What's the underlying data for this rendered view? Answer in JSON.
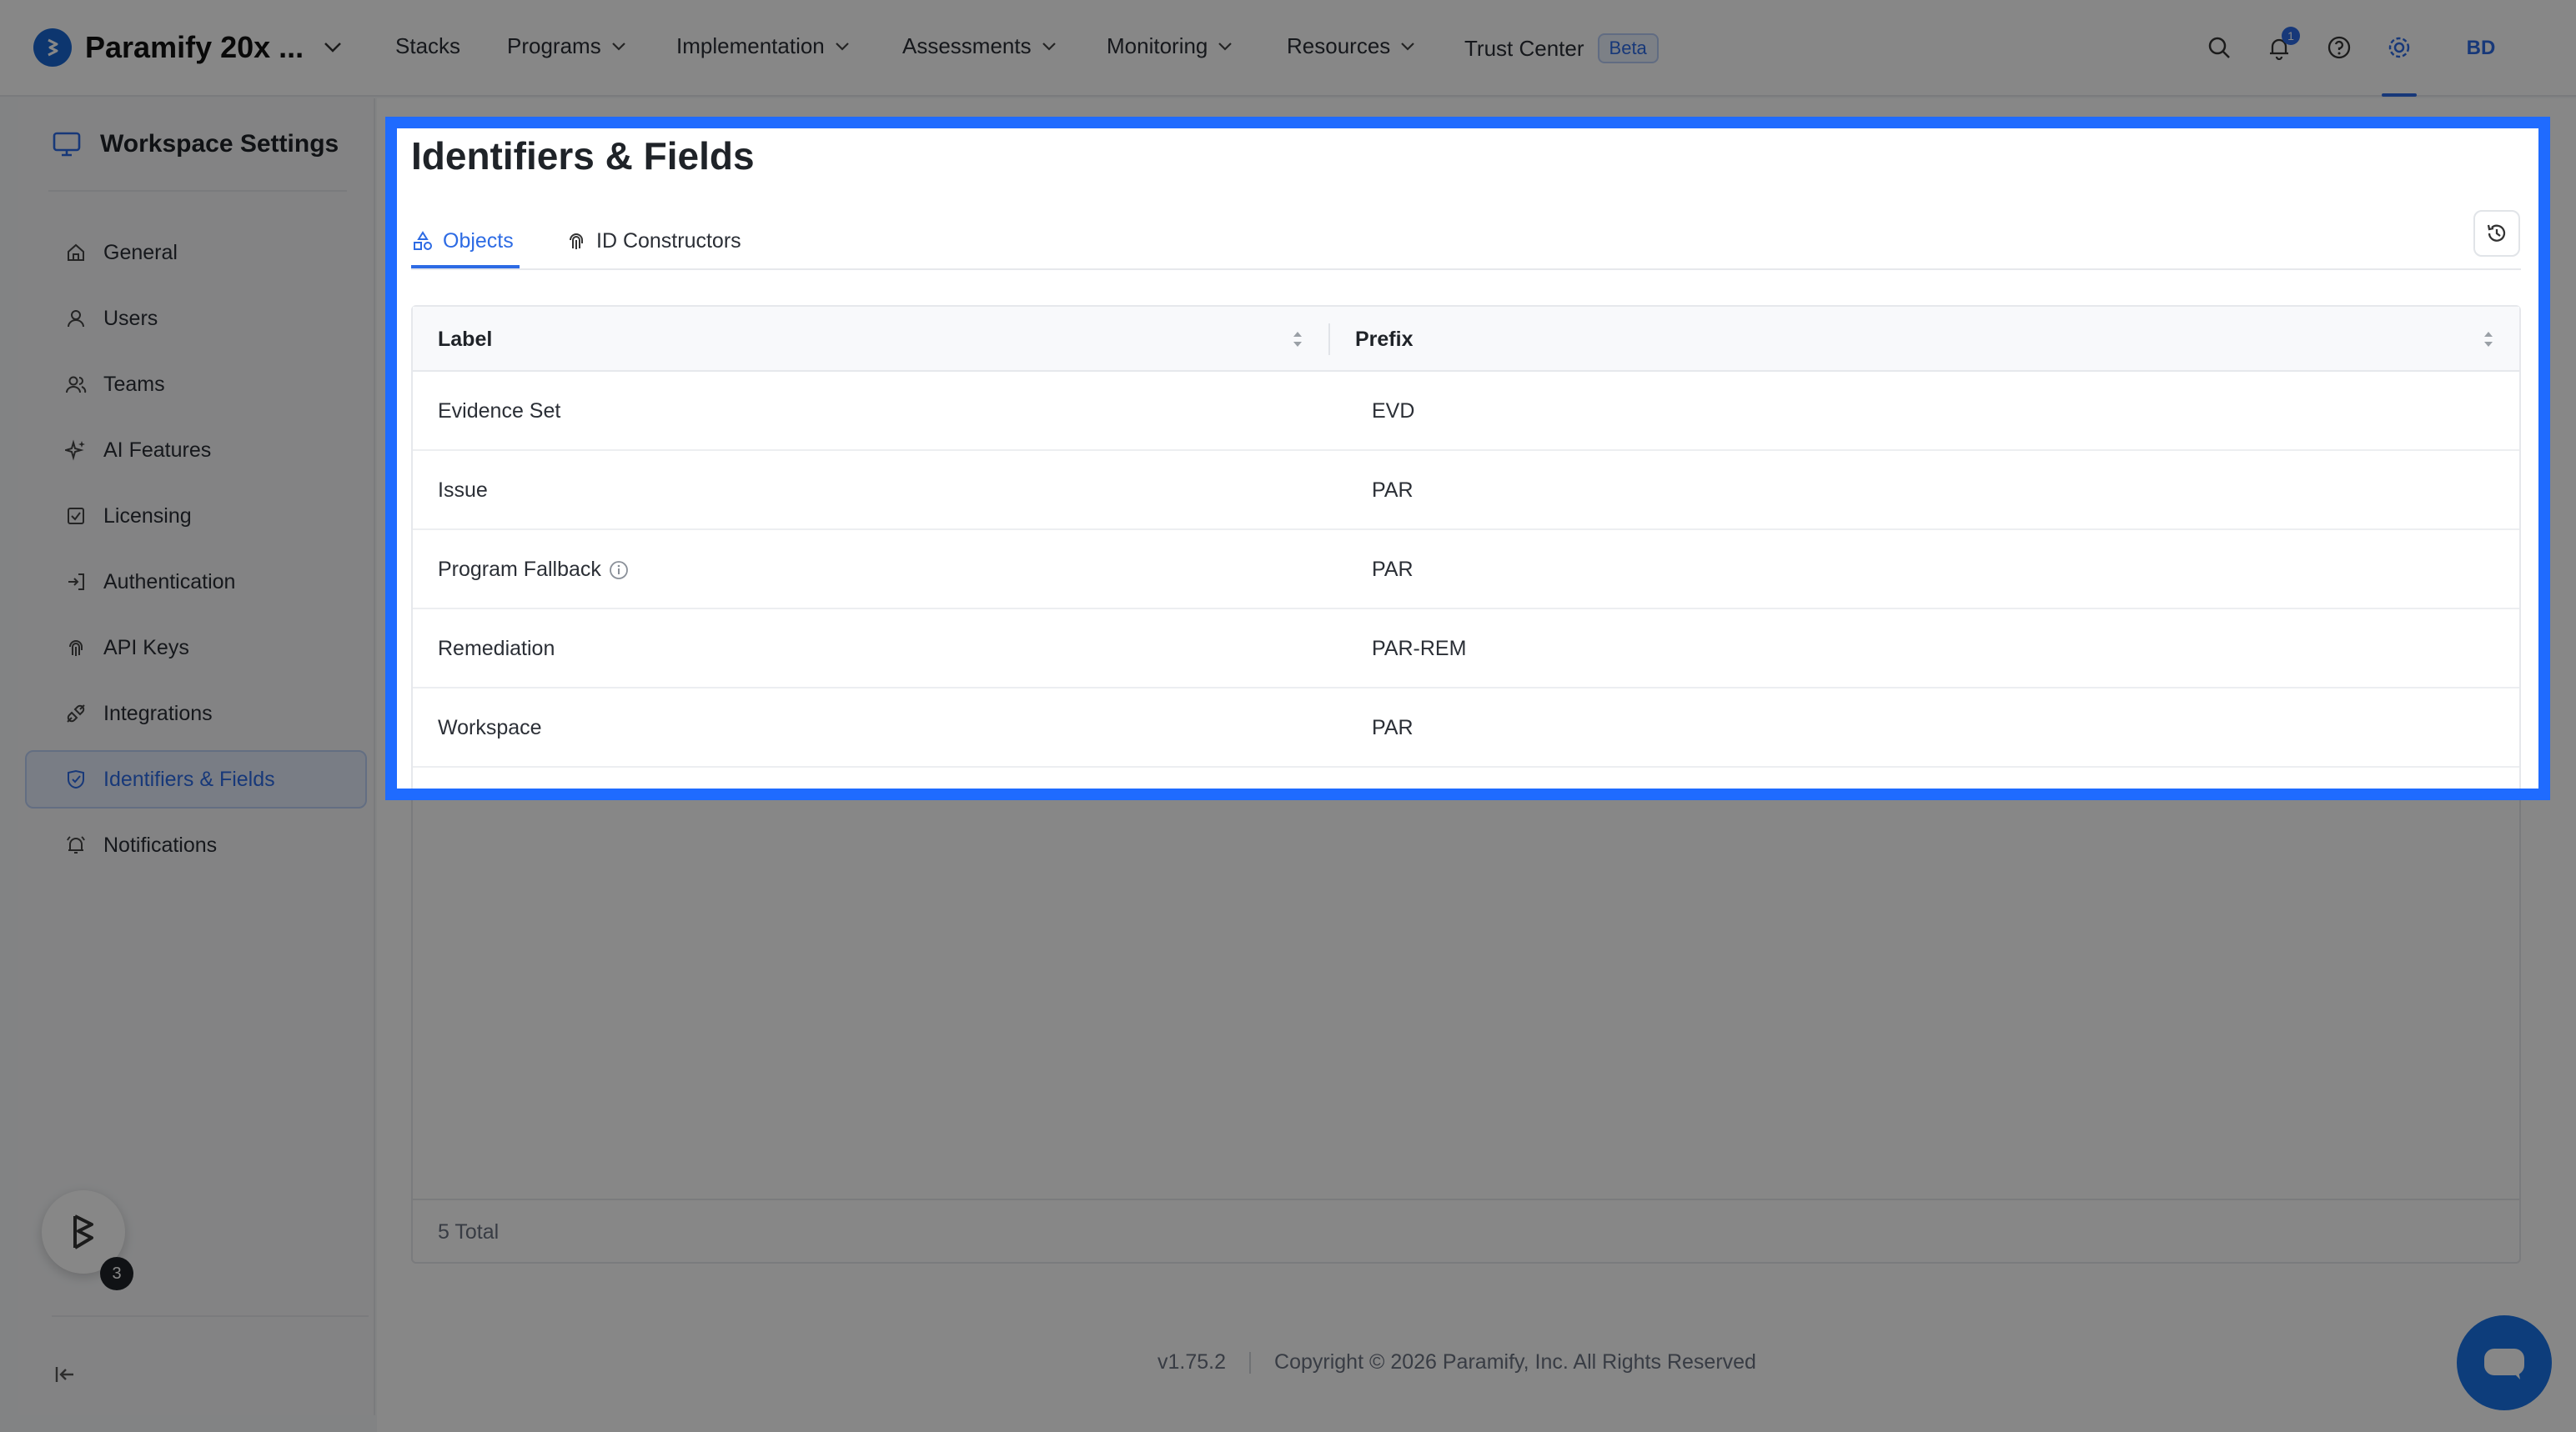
{
  "topnav": {
    "brand": "Paramify 20x ...",
    "items": [
      {
        "label": "Stacks",
        "has_chevron": false
      },
      {
        "label": "Programs",
        "has_chevron": true
      },
      {
        "label": "Implementation",
        "has_chevron": true
      },
      {
        "label": "Assessments",
        "has_chevron": true
      },
      {
        "label": "Monitoring",
        "has_chevron": true
      },
      {
        "label": "Resources",
        "has_chevron": true
      },
      {
        "label": "Trust Center",
        "has_chevron": false
      }
    ],
    "beta_badge": "Beta",
    "notification_count": "1",
    "avatar_initials": "BD",
    "icons": [
      "search-icon",
      "bell-icon",
      "help-circle-icon",
      "gear-icon"
    ]
  },
  "sidebar": {
    "title": "Workspace Settings",
    "items": [
      {
        "label": "General",
        "icon": "home-icon",
        "active": false
      },
      {
        "label": "Users",
        "icon": "user-icon",
        "active": false
      },
      {
        "label": "Teams",
        "icon": "users-icon",
        "active": false
      },
      {
        "label": "AI Features",
        "icon": "sparkle-icon",
        "active": false
      },
      {
        "label": "Licensing",
        "icon": "license-icon",
        "active": false
      },
      {
        "label": "Authentication",
        "icon": "login-icon",
        "active": false
      },
      {
        "label": "API Keys",
        "icon": "fingerprint-icon",
        "active": false
      },
      {
        "label": "Integrations",
        "icon": "plug-icon",
        "active": false
      },
      {
        "label": "Identifiers & Fields",
        "icon": "tag-icon",
        "active": true
      },
      {
        "label": "Notifications",
        "icon": "bell-ring-icon",
        "active": false
      }
    ],
    "help_count": "3"
  },
  "main": {
    "title": "Identifiers & Fields",
    "tabs": [
      {
        "label": "Objects",
        "active": true
      },
      {
        "label": "ID Constructors",
        "active": false
      }
    ],
    "table": {
      "columns": [
        "Label",
        "Prefix"
      ],
      "rows": [
        {
          "label": "Evidence Set",
          "prefix": "EVD",
          "info": false
        },
        {
          "label": "Issue",
          "prefix": "PAR",
          "info": false
        },
        {
          "label": "Program Fallback",
          "prefix": "PAR",
          "info": true
        },
        {
          "label": "Remediation",
          "prefix": "PAR-REM",
          "info": false
        },
        {
          "label": "Workspace",
          "prefix": "PAR",
          "info": false
        }
      ],
      "total": "5 Total"
    }
  },
  "footer": {
    "version": "v1.75.2",
    "copyright": "Copyright © 2026 Paramify, Inc. All Rights Reserved"
  },
  "colors": {
    "accent": "#2d6be4",
    "highlight": "#1f6bff",
    "overlay": "rgba(0,0,0,0.47)"
  }
}
